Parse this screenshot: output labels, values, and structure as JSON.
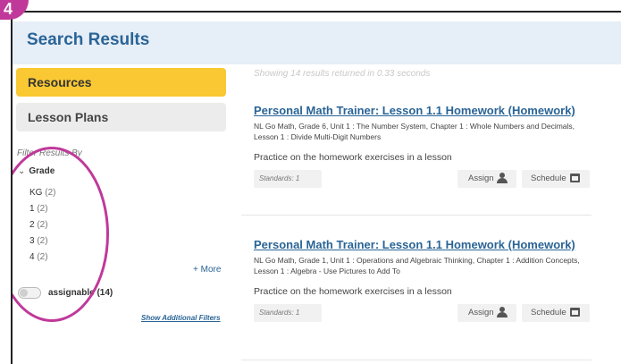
{
  "badge": {
    "step": "4"
  },
  "header": {
    "title": "Search Results"
  },
  "sidebar": {
    "tabs": [
      {
        "label": "Resources"
      },
      {
        "label": "Lesson Plans"
      }
    ],
    "filter_heading": "Filter Results By",
    "grade": {
      "label": "Grade",
      "items": [
        {
          "label": "KG",
          "count": "(2)"
        },
        {
          "label": "1",
          "count": "(2)"
        },
        {
          "label": "2",
          "count": "(2)"
        },
        {
          "label": "3",
          "count": "(2)"
        },
        {
          "label": "4",
          "count": "(2)"
        }
      ],
      "more": "+ More"
    },
    "assignable": {
      "label": "assignable (14)"
    },
    "show_additional": "Show Additional Filters"
  },
  "results": {
    "summary": "Showing 14 results returned in 0.33 seconds",
    "items": [
      {
        "title": "Personal Math Trainer: Lesson 1.1 Homework (Homework)",
        "path": "NL Go Math, Grade 6, Unit 1 : The Number System, Chapter 1 : Whole Numbers and Decimals, Lesson 1 : Divide Multi-Digit Numbers",
        "description": "Practice on the homework exercises in a lesson",
        "standards": "Standards: 1",
        "assign_label": "Assign",
        "schedule_label": "Schedule"
      },
      {
        "title": "Personal Math Trainer: Lesson 1.1 Homework (Homework)",
        "path": "NL Go Math, Grade 1, Unit 1 : Operations and Algebraic Thinking, Chapter 1 : Addition Concepts, Lesson 1 : Algebra - Use Pictures to Add To",
        "description": "Practice on the homework exercises in a lesson",
        "standards": "Standards: 1",
        "assign_label": "Assign",
        "schedule_label": "Schedule"
      }
    ]
  },
  "colors": {
    "accent": "#f9c832",
    "link": "#2a6496",
    "annotation": "#c0399a",
    "header_bg": "#e6eef7"
  }
}
